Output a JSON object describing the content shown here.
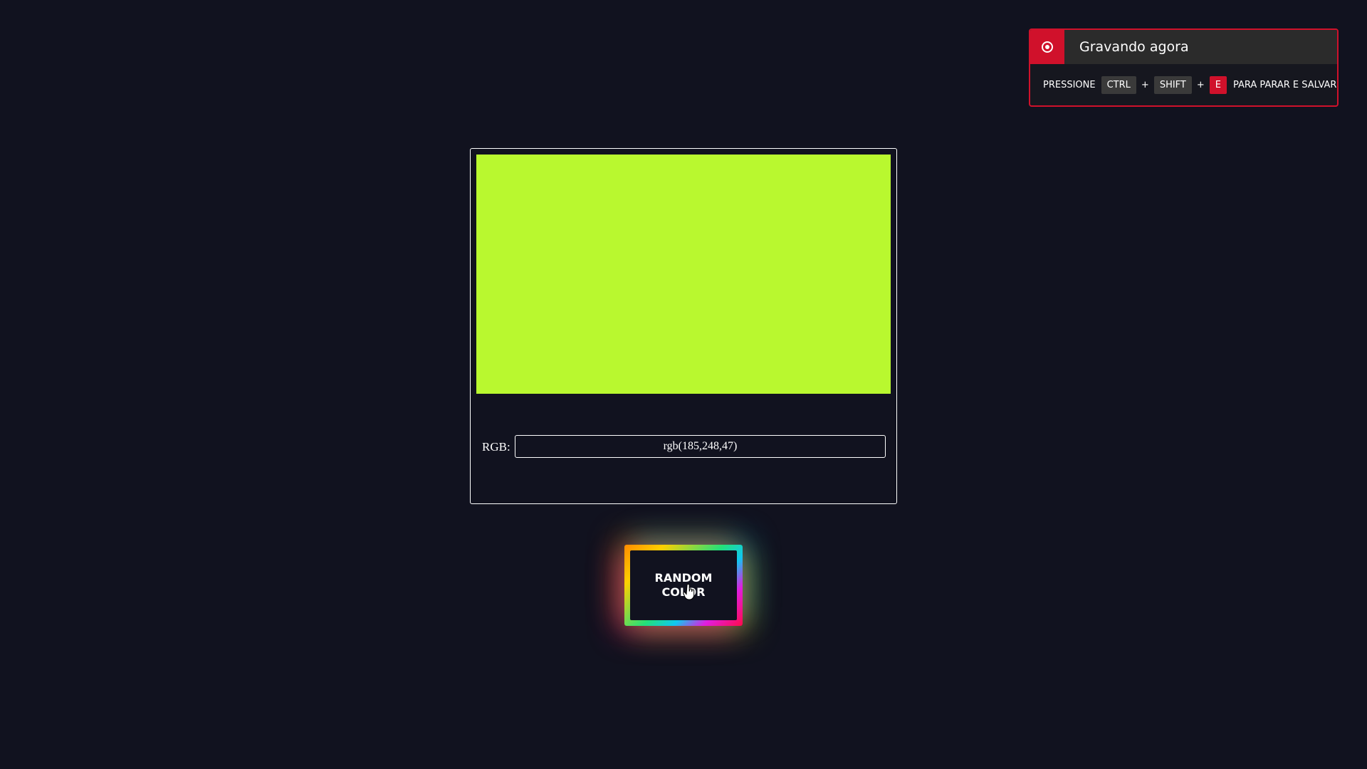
{
  "recording": {
    "title": "Gravando agora",
    "icon": "record-icon",
    "instruction_prefix": "PRESSIONE",
    "keys": [
      "CTRL",
      "SHIFT",
      "E"
    ],
    "separator": "+",
    "instruction_suffix": "PARA PARAR E SALVAR",
    "accent_color": "#d0112b"
  },
  "color_panel": {
    "swatch_color": "rgb(185,248,47)",
    "rgb_label": "RGB:",
    "rgb_value": "rgb(185,248,47)"
  },
  "button": {
    "label_line1": "RANDOM",
    "label_line2": "COLOR"
  },
  "colors": {
    "background": "#11121f",
    "swatch": "#b9f82f"
  }
}
